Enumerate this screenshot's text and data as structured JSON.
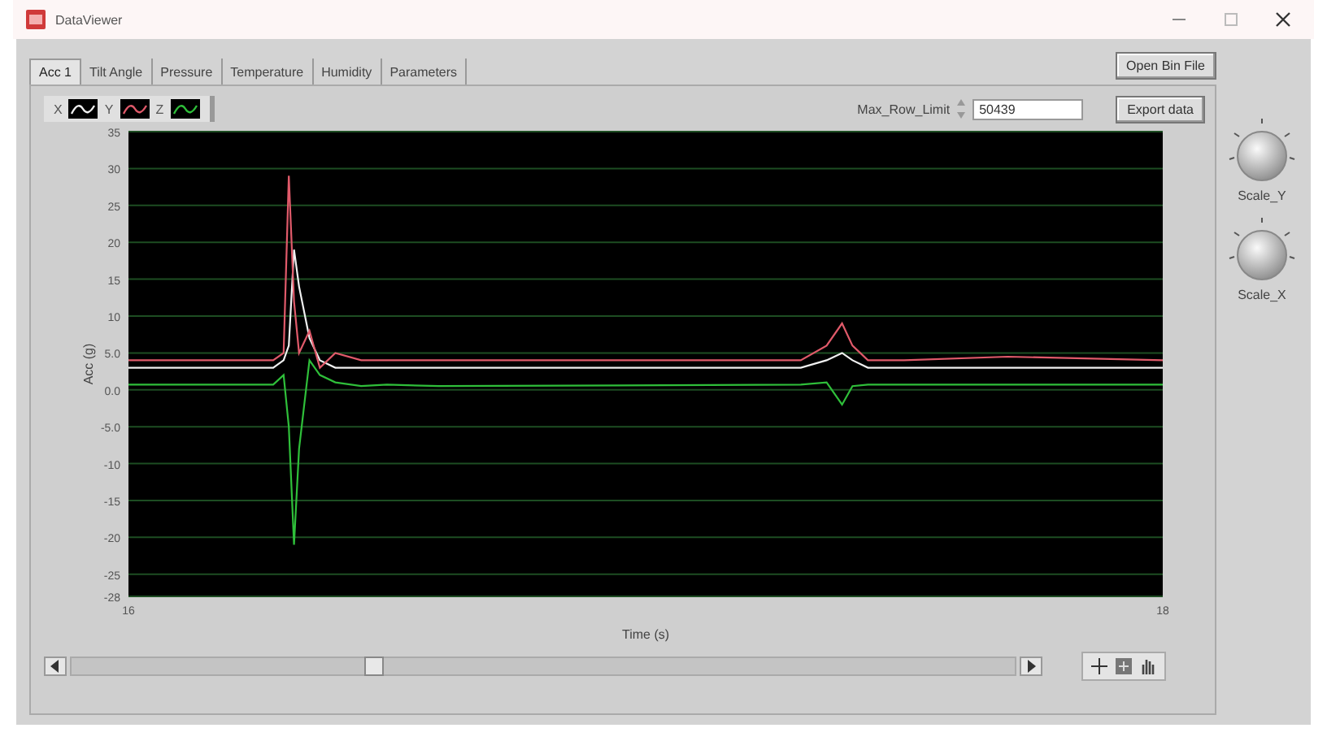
{
  "window": {
    "title": "DataViewer"
  },
  "tabs": [
    {
      "label": "Acc 1",
      "selected": true
    },
    {
      "label": "Tilt Angle",
      "selected": false
    },
    {
      "label": "Pressure",
      "selected": false
    },
    {
      "label": "Temperature",
      "selected": false
    },
    {
      "label": "Humidity",
      "selected": false
    },
    {
      "label": "Parameters",
      "selected": false
    }
  ],
  "open_button": "Open Bin File",
  "export_button": "Export data",
  "max_row_limit": {
    "label": "Max_Row_Limit",
    "value": "50439"
  },
  "knobs": [
    {
      "label": "Scale_Y"
    },
    {
      "label": "Scale_X"
    }
  ],
  "chart_data": {
    "type": "line",
    "grid": true,
    "xlabel": "Time (s)",
    "ylabel": "Acc (g)",
    "xlim": [
      16,
      18
    ],
    "ylim": [
      -28,
      35
    ],
    "xticks": [
      16,
      18
    ],
    "yticks": [
      35,
      30,
      25,
      20,
      15,
      10,
      {
        "value": 5,
        "label": "5.0"
      },
      {
        "value": 0,
        "label": "0.0"
      },
      {
        "value": -5,
        "label": "-5.0"
      },
      -10,
      -15,
      -20,
      -25,
      -28
    ],
    "x": [
      16,
      16.28,
      16.3,
      16.31,
      16.32,
      16.33,
      16.35,
      16.37,
      16.4,
      16.45,
      16.5,
      16.6,
      17.3,
      17.35,
      17.38,
      17.4,
      17.43,
      17.5,
      17.7,
      18
    ],
    "series": [
      {
        "name": "X",
        "color": "#f0f0f0",
        "values": [
          3,
          3,
          4,
          6,
          19,
          14,
          7,
          4,
          3,
          3,
          3,
          3,
          3,
          4,
          5,
          4,
          3,
          3,
          3,
          3
        ]
      },
      {
        "name": "Y",
        "color": "#e05a6a",
        "values": [
          4,
          4,
          5,
          29,
          12,
          5,
          8,
          3,
          5,
          4,
          4,
          4,
          4,
          6,
          9,
          6,
          4,
          4,
          4.5,
          4
        ]
      },
      {
        "name": "Z",
        "color": "#2fbf3a",
        "values": [
          0.7,
          0.7,
          2,
          -5,
          -21,
          -8,
          4,
          2,
          1,
          0.5,
          0.7,
          0.5,
          0.7,
          1,
          -2,
          0.5,
          0.7,
          0.7,
          0.7,
          0.7
        ]
      }
    ]
  }
}
